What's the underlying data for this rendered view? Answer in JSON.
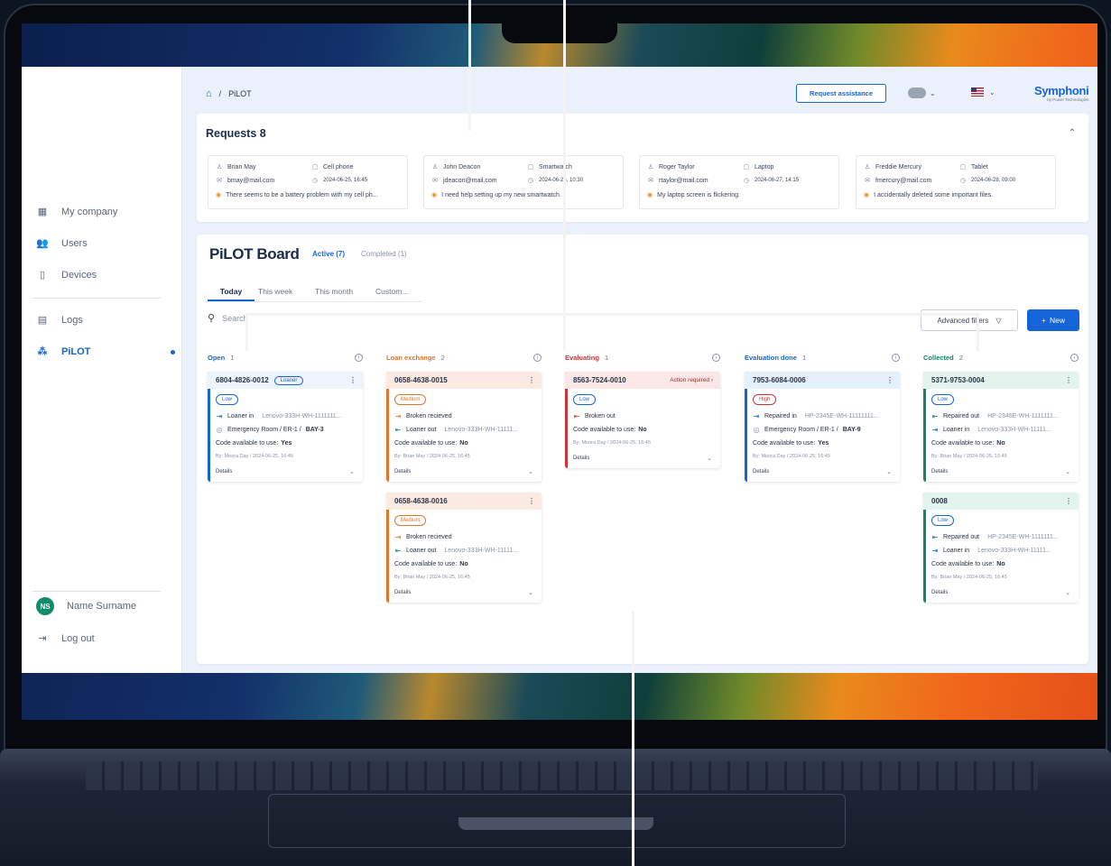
{
  "breadcrumb": {
    "current": "PiLOT"
  },
  "header": {
    "request_assistance": "Request assistance",
    "logo": "Symphoni",
    "logo_sub": "by Power Technologies"
  },
  "sidebar": {
    "items": [
      {
        "label": "My company",
        "icon": "grid-icon"
      },
      {
        "label": "Users",
        "icon": "users-icon"
      },
      {
        "label": "Devices",
        "icon": "phone-icon"
      },
      {
        "label": "Logs",
        "icon": "document-icon"
      },
      {
        "label": "PiLOT",
        "icon": "team-icon",
        "active": true
      }
    ],
    "user": {
      "initials": "NS",
      "name": "Name Surname"
    },
    "logout": "Log out"
  },
  "requests": {
    "title": "Requests 8",
    "cards": [
      {
        "name": "Brian May",
        "device": "Cell phone",
        "email": "bmay@mail.com",
        "date": "2024-06-25, 16:45",
        "message": "There seems to be a battery problem with my cell ph..."
      },
      {
        "name": "John Deacon",
        "device": "Smartwatch",
        "email": "jdeacon@mail.com",
        "date": "2024-06-26, 10:30",
        "message": "I need help setting up my new smartwatch."
      },
      {
        "name": "Roger Taylor",
        "device": "Laptop",
        "email": "rtaylor@mail.com",
        "date": "2024-06-27, 14:15",
        "message": "My laptop screen is flickering."
      },
      {
        "name": "Freddie Mercury",
        "device": "Tablet",
        "email": "fmercury@mail.com",
        "date": "2024-06-28, 09:00",
        "message": "I accidentally deleted some important files."
      }
    ]
  },
  "board": {
    "title": "PiLOT Board",
    "status_tabs": [
      {
        "label": "Active (7)"
      },
      {
        "label": "Completed (1)"
      }
    ],
    "time_tabs": [
      {
        "label": "Today"
      },
      {
        "label": "This week"
      },
      {
        "label": "This month"
      },
      {
        "label": "Custom..."
      }
    ],
    "search_placeholder": "Search",
    "advanced_filters": "Advanced filters",
    "new_button": "New",
    "columns": [
      {
        "name": "Open",
        "count": "1",
        "color": "#1565d8",
        "cards": [
          {
            "id": "6804-4826-0012",
            "tag": "Loaner",
            "priority": "Low",
            "lines": [
              {
                "icon": "in",
                "text": "Loaner in",
                "sub": "Lenovo-333H-WH-1111111..."
              },
              {
                "icon": "pin",
                "text": "Emergency Room / ER-1 / ",
                "bold": "BAY-3"
              }
            ],
            "code_label": "Code available to use:",
            "code": "Yes",
            "by": "By: Moora Day / 2024-06-25, 16:45",
            "details": "Details"
          }
        ]
      },
      {
        "name": "Loan exchange",
        "count": "2",
        "color": "#e0762b",
        "cards": [
          {
            "id": "0658-4638-0015",
            "priority": "Medium",
            "lines": [
              {
                "icon": "in-orange",
                "text": "Broken recieved",
                "sub": ""
              },
              {
                "icon": "out",
                "text": "Loaner out",
                "sub": "Lenovo-333H-WH-11111..."
              }
            ],
            "code_label": "Code available to use:",
            "code": "No",
            "by": "By: Brian May / 2024-06-25, 16:45",
            "details": "Details"
          },
          {
            "id": "0658-4638-0016",
            "priority": "Medium",
            "lines": [
              {
                "icon": "in-orange",
                "text": "Broken recieved",
                "sub": ""
              },
              {
                "icon": "out",
                "text": "Loaner out",
                "sub": "Lenovo-333H-WH-11111..."
              }
            ],
            "code_label": "Code available to use:",
            "code": "No",
            "by": "By: Brian May / 2024-06-25, 16:45",
            "details": "Details"
          }
        ]
      },
      {
        "name": "Evaluating",
        "count": "1",
        "color": "#c8343a",
        "cards": [
          {
            "id": "8563-7524-0010",
            "action": "Action required",
            "priority": "Low",
            "lines": [
              {
                "icon": "out-red",
                "text": "Broken out",
                "sub": ""
              }
            ],
            "code_label": "Code available to use:",
            "code": "No",
            "by": "By: Moora Day / 2024-06-25, 16:45",
            "details": "Details"
          }
        ]
      },
      {
        "name": "Evaluation done",
        "count": "1",
        "color": "#1565d8",
        "cards": [
          {
            "id": "7953-6084-0006",
            "priority": "High",
            "lines": [
              {
                "icon": "in",
                "text": "Repaired in",
                "sub": "HP-2345E-WH-11111111..."
              },
              {
                "icon": "pin",
                "text": "Emergency Room / ER-1 / ",
                "bold": "BAY-9"
              }
            ],
            "code_label": "Code available to use:",
            "code": "Yes",
            "by": "By: Moora Day / 2024-06-25, 16:45",
            "details": "Details"
          }
        ]
      },
      {
        "name": "Collected",
        "count": "2",
        "color": "#12866a",
        "cards": [
          {
            "id": "5371-9753-0004",
            "priority": "Low",
            "lines": [
              {
                "icon": "out-green",
                "text": "Repaired out",
                "sub": "HP-2345E-WH-1111111..."
              },
              {
                "icon": "in",
                "text": "Loaner in",
                "sub": "Lenovo-333H-WH-11111..."
              }
            ],
            "code_label": "Code available to use:",
            "code": "No",
            "by": "By: Brian May / 2024-06-25, 16:45",
            "details": "Details"
          },
          {
            "id": "0008",
            "priority": "Low",
            "lines": [
              {
                "icon": "out-green",
                "text": "Repaired out",
                "sub": "HP-2345E-WH-1111111..."
              },
              {
                "icon": "in",
                "text": "Loaner in",
                "sub": "Lenovo-333H-WH-11111..."
              }
            ],
            "code_label": "Code available to use:",
            "code": "No",
            "by": "By: Brian May / 2024-06-25, 16:45",
            "details": "Details"
          }
        ]
      }
    ]
  }
}
